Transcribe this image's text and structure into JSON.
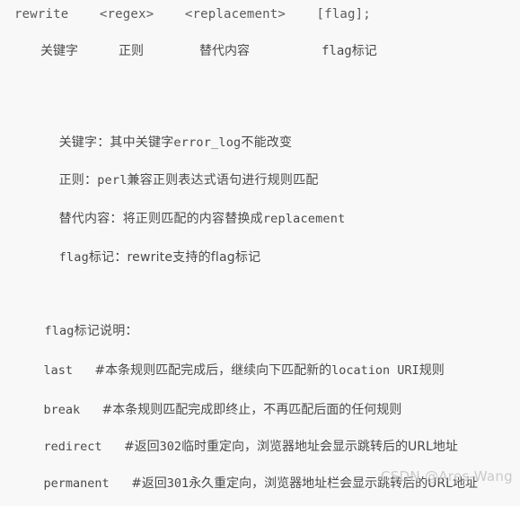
{
  "background_color": "#f8f8f8",
  "text_color": "#4a4a4a",
  "watermark_color": "#c9c9c9",
  "signature": {
    "line": "rewrite    <regex>    <replacement>    [flag];"
  },
  "annotations": {
    "keyword": "关键字",
    "regex": "正则",
    "replacement": "替代内容",
    "flag": "flag标记"
  },
  "descriptions": [
    {
      "label": "关键字：其中关键字",
      "mono": "error_log",
      "tail": "不能改变"
    },
    {
      "label": "正则：",
      "mono": "perl",
      "tail": "兼容正则表达式语句进行规则匹配"
    },
    {
      "label": "替代内容：将正则匹配的内容替换成",
      "mono": "replacement",
      "tail": ""
    },
    {
      "label": "",
      "mono": "flag",
      "tail": "标记：rewrite支持的flag标记"
    }
  ],
  "flag_section": {
    "heading_mono": "flag",
    "heading_cn": "标记说明：",
    "rows": [
      {
        "name": "last",
        "gap": "   ",
        "note_before": "#本条规则匹配完成后，继续向下匹配新的",
        "note_mono": "location URI",
        "note_after": "规则"
      },
      {
        "name": "break",
        "gap": "   ",
        "note_before": "#本条规则匹配完成即终止，不再匹配后面的任何规则",
        "note_mono": "",
        "note_after": ""
      },
      {
        "name": "redirect",
        "gap": "   ",
        "note_before": "#返回",
        "note_mono": "302",
        "note_after": "临时重定向，浏览器地址会显示跳转后的URL地址"
      },
      {
        "name": "permanent",
        "gap": "   ",
        "note_before": "#返回",
        "note_mono": "301",
        "note_after": "永久重定向，浏览器地址栏会显示跳转后的URL地址"
      }
    ]
  },
  "watermark": {
    "text": "CSDN @Ares-Wang"
  }
}
